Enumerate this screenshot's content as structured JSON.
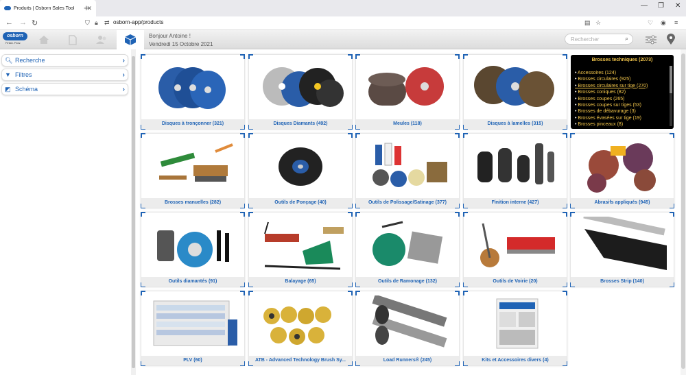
{
  "browser": {
    "tab_title": "Produits | Osborn Sales Tool",
    "tab_close": "✕",
    "new_tab": "+",
    "url": "osborn-app/products",
    "back_icon": "←",
    "forward_icon": "→",
    "reload_icon": "↻"
  },
  "header": {
    "logo_text": "osborn",
    "logo_tagline": "Finish. Flow.",
    "greeting": "Bonjour Antoine !",
    "date": "Vendredi 15 Octobre 2021",
    "search_placeholder": "Rechercher"
  },
  "sidebar": {
    "items": [
      {
        "label": "Recherche",
        "icon": "search-icon"
      },
      {
        "label": "Filtres",
        "icon": "filter-icon"
      },
      {
        "label": "Schéma",
        "icon": "diagram-icon"
      }
    ]
  },
  "products": [
    {
      "label": "Disques à tronçonner (321)",
      "art": "discs-blue"
    },
    {
      "label": "Disques Diamants (492)",
      "art": "discs-diamond"
    },
    {
      "label": "Meules (118)",
      "art": "wheels"
    },
    {
      "label": "Disques à lamelles (315)",
      "art": "flap"
    },
    {
      "label": "Brosses manuelles (282)",
      "art": "hand"
    },
    {
      "label": "Outils de Ponçage (40)",
      "art": "sanding"
    },
    {
      "label": "Outils de Polissage/Satinage (377)",
      "art": "polish"
    },
    {
      "label": "Finition interne (427)",
      "art": "internal"
    },
    {
      "label": "Abrasifs appliqués (945)",
      "art": "abrasives"
    },
    {
      "label": "Outils diamantés (91)",
      "art": "diamond-tools"
    },
    {
      "label": "Balayage (65)",
      "art": "sweeping"
    },
    {
      "label": "Outils de Ramonage (132)",
      "art": "chimney"
    },
    {
      "label": "Outils de Voirie (20)",
      "art": "road"
    },
    {
      "label": "Brosses Strip (140)",
      "art": "strip"
    },
    {
      "label": "PLV (60)",
      "art": "display"
    },
    {
      "label": "ATB - Advanced Technology Brush Sy...",
      "art": "atb"
    },
    {
      "label": "Load Runners® (245)",
      "art": "runners"
    },
    {
      "label": "Kits et Accessoires divers (4)",
      "art": "kits"
    }
  ],
  "tech_brushes": {
    "title": "Brosses techniques (2073)",
    "items": [
      "Accessoires (124)",
      "Brosses circulaires (925)",
      "Brosses circulaires sur tige (270)",
      "Brosses coniques (82)",
      "Brosses coupes (265)",
      "Brosses coupes sur tiges (53)",
      "Brosses de débavurage (3)",
      "Brosses évasées sur tige (19)",
      "Brosses pinceaux (8)"
    ]
  },
  "colors": {
    "brand_blue": "#1f63b5",
    "tech_text": "#f5c84c"
  }
}
